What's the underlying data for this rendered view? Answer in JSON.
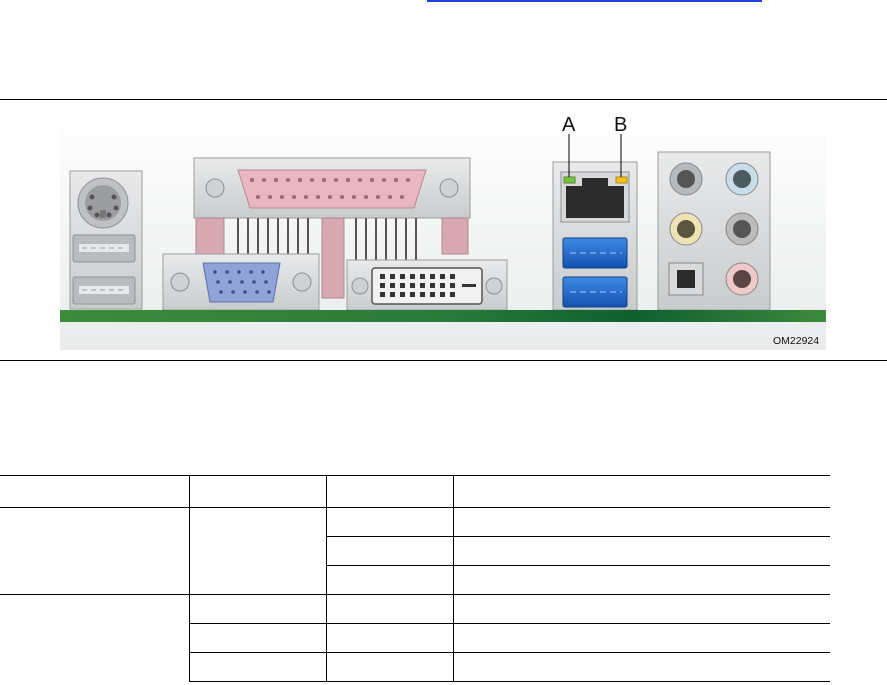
{
  "diagram": {
    "callouts": [
      "A",
      "B"
    ],
    "drawing_code": "OM22924",
    "colors": {
      "usb3_blue": "#1f6fd0",
      "board_green": "#2c7a38",
      "led_green": "#7cc242",
      "led_yellow": "#f2c21b",
      "parallel_pink": "#e8b7c0",
      "vga_blue": "#8fa3d8"
    },
    "icons": [
      "ps2-port-icon",
      "usb2-port-icon",
      "parallel-port-icon",
      "vga-port-icon",
      "dvi-port-icon",
      "rj45-port-icon",
      "usb3-port-icon",
      "audio-jack-icon",
      "spdif-port-icon"
    ]
  },
  "table": {
    "rows": 7,
    "columns": 4
  }
}
